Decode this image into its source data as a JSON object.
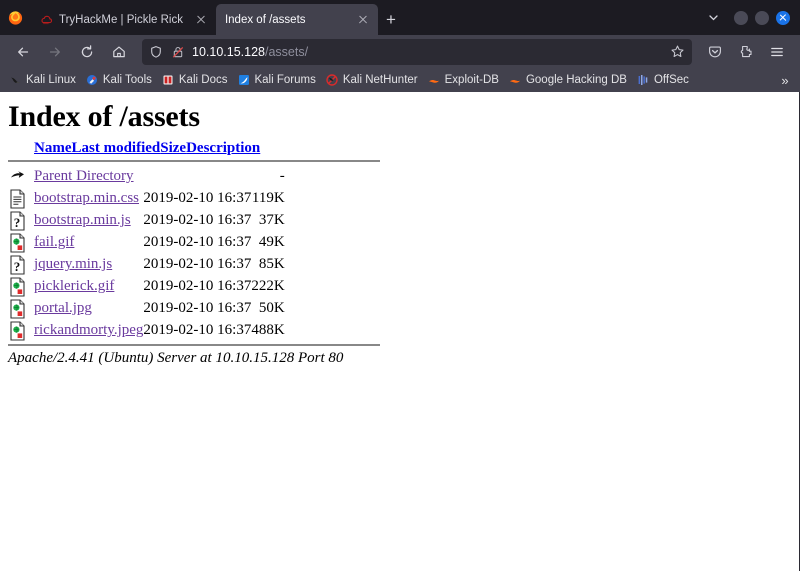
{
  "window": {
    "controls": {
      "minimize": "minimize",
      "maximize": "maximize",
      "close": "close"
    },
    "tablist_chevron": "chevron-down",
    "close_color": "#1a73e8"
  },
  "tabstrip": {
    "firefox_logo": "firefox-logo",
    "new_tab_label": "+",
    "tabs": [
      {
        "title": "TryHackMe | Pickle Rick",
        "favicon": "tryhackme-favicon",
        "active": false
      },
      {
        "title": "Index of /assets",
        "favicon": "none",
        "active": true
      }
    ]
  },
  "toolbar": {
    "back": "back-arrow-icon",
    "forward": "forward-arrow-icon",
    "reload": "reload-icon",
    "home": "home-icon",
    "url_host": "10.10.15.128",
    "url_path": "/assets/",
    "url_full": "10.10.15.128/assets/",
    "shield_icon": "tracking-protection-shield-icon",
    "lock_icon": "connection-not-secure-icon",
    "bookmark_star": "bookmark-star-icon",
    "pocket": "save-to-pocket-icon",
    "extensions": "extensions-icon",
    "app_menu": "hamburger-menu-icon"
  },
  "bookmarks": {
    "overflow_label": "»",
    "items": [
      {
        "label": "Kali Linux",
        "icon": "kali-dragon-icon"
      },
      {
        "label": "Kali Tools",
        "icon": "kali-tools-icon"
      },
      {
        "label": "Kali Docs",
        "icon": "kali-docs-icon"
      },
      {
        "label": "Kali Forums",
        "icon": "kali-forums-icon"
      },
      {
        "label": "Kali NetHunter",
        "icon": "kali-nethunter-icon"
      },
      {
        "label": "Exploit-DB",
        "icon": "exploit-db-icon"
      },
      {
        "label": "Google Hacking DB",
        "icon": "google-hacking-db-icon"
      },
      {
        "label": "OffSec",
        "icon": "offsec-icon"
      }
    ]
  },
  "page": {
    "title": "Index of /assets",
    "columns": {
      "name": "Name",
      "last_modified": "Last modified",
      "size": "Size",
      "description": "Description"
    },
    "rows": [
      {
        "icon": "parent-directory-icon",
        "name": "Parent Directory",
        "last_modified": "",
        "size": "-",
        "description": ""
      },
      {
        "icon": "text-file-icon",
        "name": "bootstrap.min.css",
        "last_modified": "2019-02-10 16:37",
        "size": "119K",
        "description": ""
      },
      {
        "icon": "unknown-file-icon",
        "name": "bootstrap.min.js",
        "last_modified": "2019-02-10 16:37",
        "size": "37K",
        "description": ""
      },
      {
        "icon": "image-file-icon",
        "name": "fail.gif",
        "last_modified": "2019-02-10 16:37",
        "size": "49K",
        "description": ""
      },
      {
        "icon": "unknown-file-icon",
        "name": "jquery.min.js",
        "last_modified": "2019-02-10 16:37",
        "size": "85K",
        "description": ""
      },
      {
        "icon": "image-file-icon",
        "name": "picklerick.gif",
        "last_modified": "2019-02-10 16:37",
        "size": "222K",
        "description": ""
      },
      {
        "icon": "image-file-icon",
        "name": "portal.jpg",
        "last_modified": "2019-02-10 16:37",
        "size": "50K",
        "description": ""
      },
      {
        "icon": "image-file-icon",
        "name": "rickandmorty.jpeg",
        "last_modified": "2019-02-10 16:37",
        "size": "488K",
        "description": ""
      }
    ],
    "footer": "Apache/2.4.41 (Ubuntu) Server at 10.10.15.128 Port 80",
    "link_color": "#6a3a9e",
    "header_link_color": "#0000ee"
  }
}
